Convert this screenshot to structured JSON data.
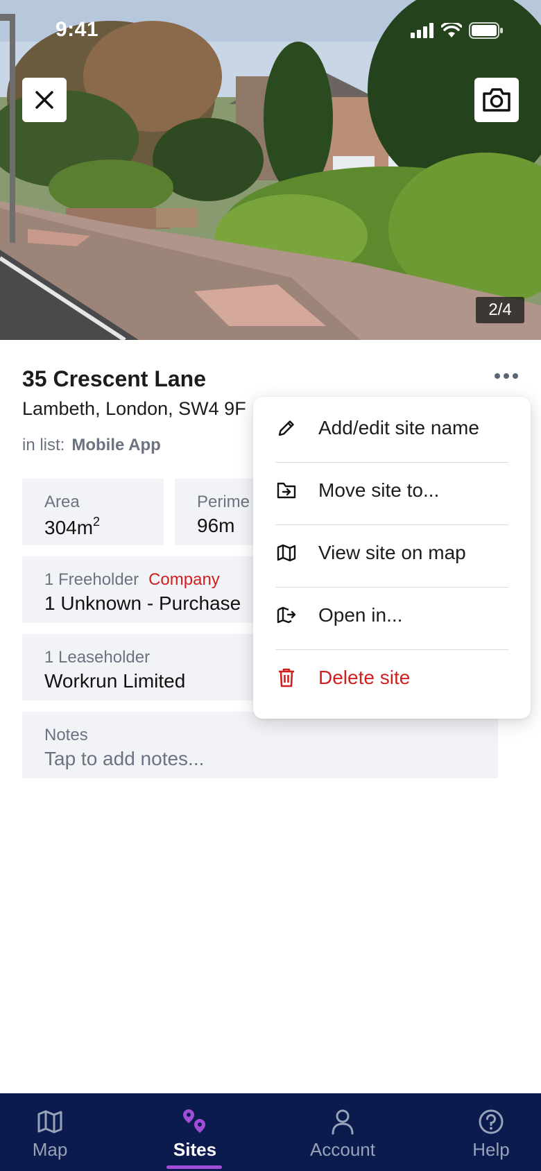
{
  "status_bar": {
    "time": "9:41"
  },
  "photo": {
    "counter": "2/4"
  },
  "site": {
    "title": "35 Crescent Lane",
    "address": "Lambeth, London, SW4 9F",
    "list_label": "in list:",
    "list_name": "Mobile App"
  },
  "stats": {
    "area_label": "Area",
    "area_value": "304m",
    "area_unit_sup": "2",
    "perimeter_label": "Perime",
    "perimeter_value": "96m"
  },
  "freeholder": {
    "label": "1 Freeholder",
    "tag": "Company",
    "value": "1 Unknown - Purchase"
  },
  "leaseholder": {
    "label": "1 Leaseholder",
    "value": "Workrun Limited"
  },
  "notes": {
    "label": "Notes",
    "placeholder": "Tap to add notes..."
  },
  "menu": {
    "items": [
      {
        "label": "Add/edit site name",
        "icon": "pencil-icon"
      },
      {
        "label": "Move site to...",
        "icon": "folder-move-icon"
      },
      {
        "label": "View site on map",
        "icon": "map-icon"
      },
      {
        "label": "Open in...",
        "icon": "map-open-icon"
      },
      {
        "label": "Delete site",
        "icon": "trash-icon"
      }
    ],
    "danger_color": "#d11f1f"
  },
  "bottom_nav": {
    "items": [
      {
        "label": "Map",
        "icon": "map-icon"
      },
      {
        "label": "Sites",
        "icon": "sites-pin-icon"
      },
      {
        "label": "Account",
        "icon": "user-icon"
      },
      {
        "label": "Help",
        "icon": "help-icon"
      }
    ],
    "active": "Sites",
    "background": "#0c1b4d",
    "accent": "#a24dd8"
  }
}
